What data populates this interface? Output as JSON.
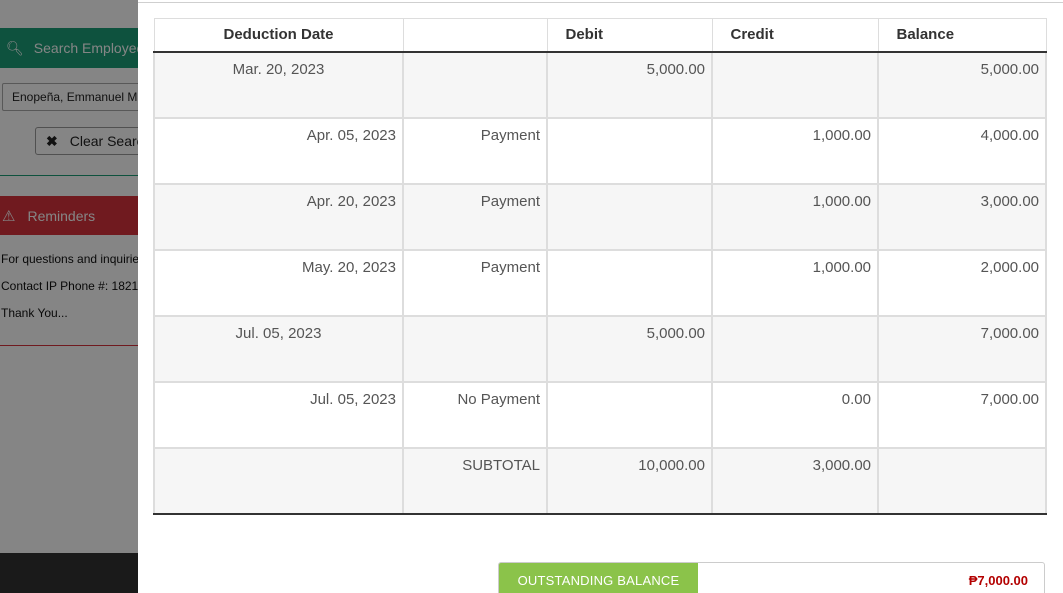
{
  "background": {
    "search_button_label": "Search Employee",
    "employee_field_value": "Enopeña, Emmanuel M.",
    "clear_button_label": "Clear Search",
    "reminders_label": "Reminders",
    "reminder_lines": [
      "For questions and inquiries",
      "Contact IP Phone #: 1821",
      "Thank You..."
    ]
  },
  "ledger": {
    "headers": {
      "date": "Deduction Date",
      "remark": "",
      "debit": "Debit",
      "credit": "Credit",
      "balance": "Balance"
    },
    "rows": [
      {
        "date": "Mar. 20, 2023",
        "remark": "",
        "debit": "5,000.00",
        "credit": "",
        "balance": "5,000.00"
      },
      {
        "date": "Apr. 05, 2023",
        "remark": "Payment",
        "debit": "",
        "credit": "1,000.00",
        "balance": "4,000.00"
      },
      {
        "date": "Apr. 20, 2023",
        "remark": "Payment",
        "debit": "",
        "credit": "1,000.00",
        "balance": "3,000.00"
      },
      {
        "date": "May. 20, 2023",
        "remark": "Payment",
        "debit": "",
        "credit": "1,000.00",
        "balance": "2,000.00"
      },
      {
        "date": "Jul. 05, 2023",
        "remark": "",
        "debit": "5,000.00",
        "credit": "",
        "balance": "7,000.00"
      },
      {
        "date": "Jul. 05, 2023",
        "remark": "No Payment",
        "debit": "",
        "credit": "0.00",
        "balance": "7,000.00"
      }
    ],
    "subtotal": {
      "label": "SUBTOTAL",
      "debit": "10,000.00",
      "credit": "3,000.00",
      "balance": ""
    }
  },
  "outstanding": {
    "label": "OUTSTANDING BALANCE",
    "value": "₱7,000.00"
  },
  "colors": {
    "payment": "#1f7a1f",
    "no_payment": "#cc1f1f",
    "subtotal": "#1a1a80",
    "outstanding_label_bg": "#8bc34a",
    "outstanding_value": "#b30000"
  }
}
